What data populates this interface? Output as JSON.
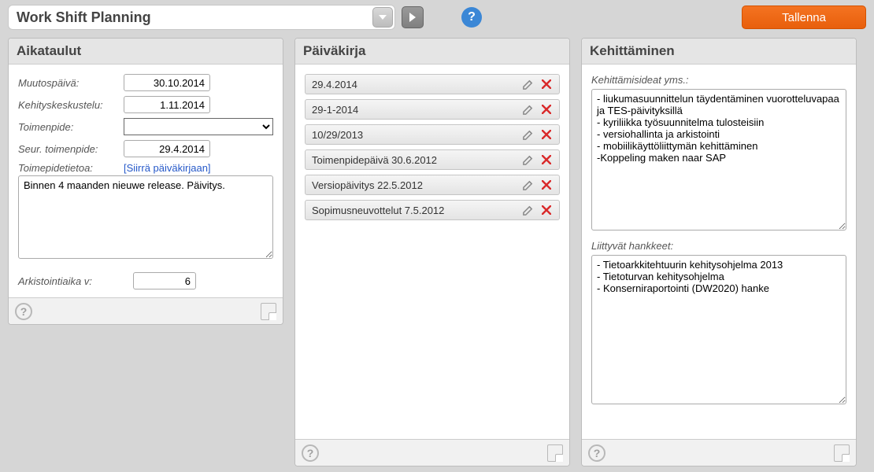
{
  "header": {
    "title": "Work Shift Planning",
    "save_label": "Tallenna"
  },
  "panels": {
    "schedule": {
      "title": "Aikataulut",
      "labels": {
        "muutospaiva": "Muutospäivä:",
        "kehityskeskustelu": "Kehityskeskustelu:",
        "toimenpide": "Toimenpide:",
        "seur_toimenpide": "Seur. toimenpide:",
        "toimenpidetietoa": "Toimepidetietoa:",
        "siirra_link": "[Siirrä päiväkirjaan]",
        "arkistointiaika": "Arkistointiaika v:"
      },
      "values": {
        "muutospaiva": "30.10.2014",
        "kehityskeskustelu": "1.11.2014",
        "toimenpide": "",
        "seur_toimenpide": "29.4.2014",
        "notes": "Binnen 4 maanden nieuwe release. Päivitys.",
        "arkistointiaika": "6"
      }
    },
    "diary": {
      "title": "Päiväkirja",
      "items": [
        "29.4.2014",
        "29-1-2014",
        "10/29/2013",
        "Toimenpidepäivä 30.6.2012",
        "Versiopäivitys 22.5.2012",
        "Sopimusneuvottelut 7.5.2012"
      ]
    },
    "development": {
      "title": "Kehittäminen",
      "labels": {
        "ideas": "Kehittämisideat yms.:",
        "related": "Liittyvät hankkeet:"
      },
      "values": {
        "ideas": "- liukumasuunnittelun täydentäminen vuorotteluvapaa ja TES-päivityksillä\n- kyriliikka työsuunnitelma tulosteisiin\n- versiohallinta ja arkistointi\n- mobiilikäyttöliittymän kehittäminen\n-Koppeling maken naar SAP",
        "related": "- Tietoarkkitehtuurin kehitysohjelma 2013\n- Tietoturvan kehitysohjelma\n- Konserniraportointi (DW2020) hanke"
      }
    }
  }
}
